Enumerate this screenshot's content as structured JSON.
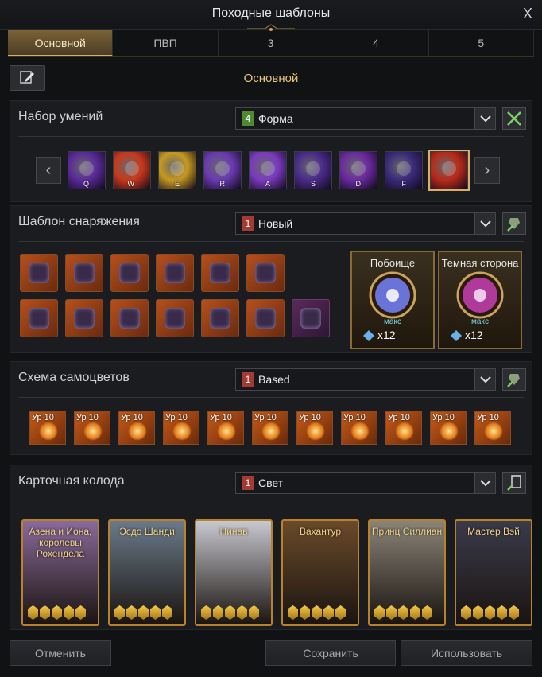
{
  "window": {
    "title": "Походные шаблоны",
    "close_label": "X"
  },
  "tabs": [
    {
      "label": "Основной",
      "active": true
    },
    {
      "label": "ПВП",
      "active": false
    },
    {
      "label": "3",
      "active": false
    },
    {
      "label": "4",
      "active": false
    },
    {
      "label": "5",
      "active": false
    }
  ],
  "preset_name": "Основной",
  "skills_section": {
    "title": "Набор умений",
    "dropdown": {
      "badge": "4",
      "value": "Форма"
    },
    "skills": [
      {
        "key": "Q",
        "icon": "dark-crescent-icon",
        "color": "#5a2a9a"
      },
      {
        "key": "W",
        "icon": "fire-slash-icon",
        "color": "#c9381a"
      },
      {
        "key": "E",
        "icon": "golden-beam-icon",
        "color": "#c69a1e"
      },
      {
        "key": "R",
        "icon": "shadow-dash-icon",
        "color": "#6a3ab0"
      },
      {
        "key": "A",
        "icon": "void-burst-icon",
        "color": "#7a3ac0"
      },
      {
        "key": "S",
        "icon": "claw-icon",
        "color": "#4a2a8a"
      },
      {
        "key": "D",
        "icon": "blade-drop-icon",
        "color": "#6a2aa0"
      },
      {
        "key": "F",
        "icon": "spiral-icon",
        "color": "#3a2a7a"
      },
      {
        "key": "",
        "icon": "crimson-slash-icon",
        "color": "#b82a18"
      }
    ]
  },
  "equipment_section": {
    "title": "Шаблон снаряжения",
    "dropdown": {
      "badge": "1",
      "value": "Новый"
    },
    "items": [
      {
        "name": "helmet-horns-icon"
      },
      {
        "name": "shoulder-armor-icon"
      },
      {
        "name": "chest-armor-icon"
      },
      {
        "name": "leg-armor-icon"
      },
      {
        "name": "gloves-icon"
      },
      {
        "name": "weapon-icon"
      },
      {
        "name": "necklace-icon"
      },
      {
        "name": "earring-icon"
      },
      {
        "name": "earring-icon"
      },
      {
        "name": "ring-icon"
      },
      {
        "name": "ring-icon"
      },
      {
        "name": "bracelet-icon"
      },
      {
        "name": "ability-stone-crystal-icon"
      }
    ],
    "stones": [
      {
        "name": "Побоище",
        "level": "макс",
        "count": "x12",
        "orb": "#6a74d8"
      },
      {
        "name": "Темная сторона",
        "level": "макс",
        "count": "x12",
        "orb": "#b03a9a"
      }
    ]
  },
  "gems_section": {
    "title": "Схема самоцветов",
    "dropdown": {
      "badge": "1",
      "value": "Based"
    },
    "gems": [
      "Ур 10",
      "Ур 10",
      "Ур 10",
      "Ур 10",
      "Ур 10",
      "Ур 10",
      "Ур 10",
      "Ур 10",
      "Ур 10",
      "Ур 10",
      "Ур 10"
    ]
  },
  "cards_section": {
    "title": "Карточная колода",
    "dropdown": {
      "badge": "1",
      "value": "Свет"
    },
    "cards": [
      {
        "name": "Азена и Иона, королевы Рохендела",
        "bg": "#8a6a9a",
        "awakening": 5
      },
      {
        "name": "Эсдо Шанди",
        "bg": "#6a7a8a",
        "awakening": 5
      },
      {
        "name": "Нинав",
        "bg": "#c8c8d0",
        "awakening": 5
      },
      {
        "name": "Вахантур",
        "bg": "#6a4a2a",
        "awakening": 5
      },
      {
        "name": "Принц Силлиан",
        "bg": "#8a8478",
        "awakening": 5
      },
      {
        "name": "Мастер Вэй",
        "bg": "#3a3a4a",
        "awakening": 5
      }
    ]
  },
  "footer": {
    "cancel": "Отменить",
    "save": "Сохранить",
    "use": "Использовать"
  }
}
